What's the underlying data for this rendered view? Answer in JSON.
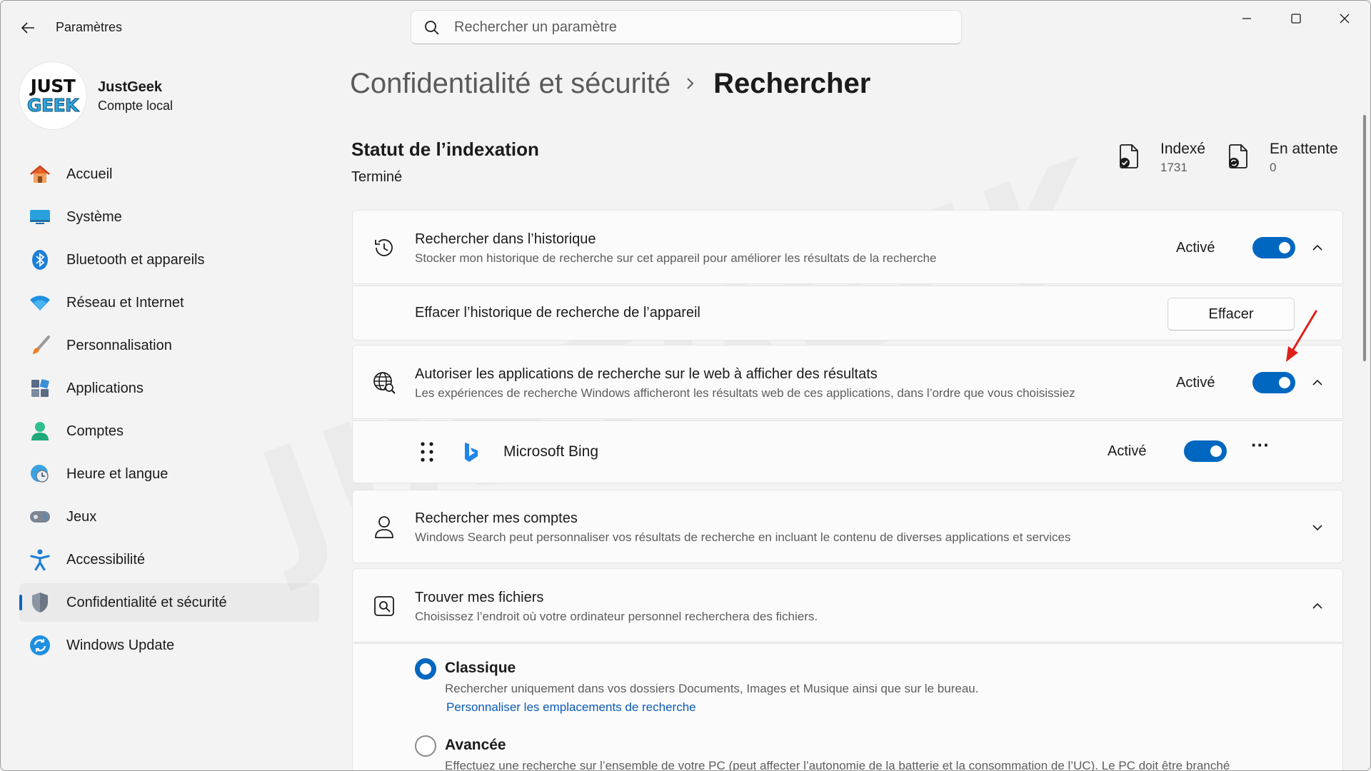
{
  "titlebar": {
    "app_title": "Paramètres",
    "search_placeholder": "Rechercher un paramètre"
  },
  "profile": {
    "logo_line1": "JUST",
    "logo_line2": "GEEK",
    "name": "JustGeek",
    "account_type": "Compte local"
  },
  "sidebar": {
    "items": [
      {
        "label": "Accueil",
        "icon": "home-icon"
      },
      {
        "label": "Système",
        "icon": "system-icon"
      },
      {
        "label": "Bluetooth et appareils",
        "icon": "bluetooth-icon"
      },
      {
        "label": "Réseau et Internet",
        "icon": "wifi-icon"
      },
      {
        "label": "Personnalisation",
        "icon": "brush-icon"
      },
      {
        "label": "Applications",
        "icon": "apps-icon"
      },
      {
        "label": "Comptes",
        "icon": "person-icon"
      },
      {
        "label": "Heure et langue",
        "icon": "globe-clock-icon"
      },
      {
        "label": "Jeux",
        "icon": "gamepad-icon"
      },
      {
        "label": "Accessibilité",
        "icon": "accessibility-icon"
      },
      {
        "label": "Confidentialité et sécurité",
        "icon": "shield-icon",
        "active": true
      },
      {
        "label": "Windows Update",
        "icon": "update-icon"
      }
    ]
  },
  "breadcrumb": {
    "parent": "Confidentialité et sécurité",
    "current": "Rechercher"
  },
  "indexing": {
    "title": "Statut de l’indexation",
    "status": "Terminé",
    "indexed_label": "Indexé",
    "indexed_value": "1731",
    "pending_label": "En attente",
    "pending_value": "0"
  },
  "history_card": {
    "title": "Rechercher dans l’historique",
    "description": "Stocker mon historique de recherche sur cet appareil pour améliorer les résultats de la recherche",
    "state": "Activé"
  },
  "clear_card": {
    "title": "Effacer l’historique de recherche de l’appareil",
    "button": "Effacer"
  },
  "web_card": {
    "title": "Autoriser les applications de recherche sur le web à afficher des résultats",
    "description": "Les expériences de recherche Windows afficheront les résultats web de ces applications, dans l’ordre que vous choisissiez",
    "state": "Activé"
  },
  "bing_row": {
    "name": "Microsoft Bing",
    "state": "Activé",
    "more": "···"
  },
  "accounts_card": {
    "title": "Rechercher mes comptes",
    "description": "Windows Search peut personnaliser vos résultats de recherche en incluant le contenu de diverses applications et services"
  },
  "files_card": {
    "title": "Trouver mes fichiers",
    "description": "Choisissez l’endroit où votre ordinateur personnel recherchera des fichiers.",
    "classic_title": "Classique",
    "classic_desc": "Rechercher uniquement dans vos dossiers Documents, Images et Musique ainsi que sur le bureau.",
    "classic_link": "Personnaliser les emplacements de recherche",
    "advanced_title": "Avancée",
    "advanced_desc": "Effectuez une recherche sur l’ensemble de votre PC (peut affecter l’autonomie de la batterie et la consommation de l’UC). Le PC doit être branché"
  },
  "watermark": "JUSTGEEK",
  "colors": {
    "accent": "#0067c0",
    "background": "#f3f3f3",
    "card": "#fbfbfb",
    "annotation_arrow": "#e0201b"
  }
}
